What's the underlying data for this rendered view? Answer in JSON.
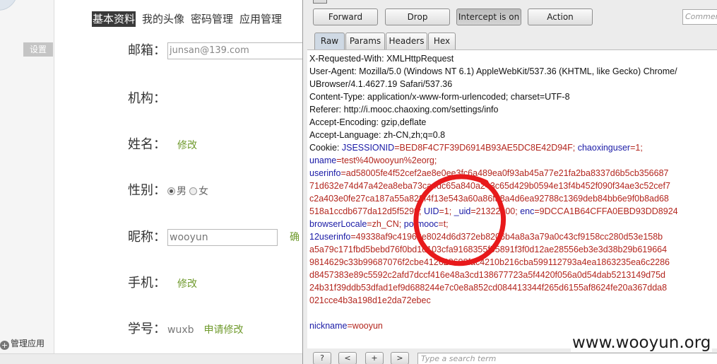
{
  "left_page": {
    "sidebar": {
      "settings_label": "设置",
      "manage_apps_label": "管理应用"
    },
    "tabs": [
      "基本资料",
      "我的头像",
      "密码管理",
      "应用管理"
    ],
    "fields": {
      "email": {
        "label": "邮箱：",
        "value": "junsan@139.com"
      },
      "org": {
        "label": "机构："
      },
      "name": {
        "label": "姓名：",
        "edit": "修改"
      },
      "gender": {
        "label": "性别：",
        "male": "男",
        "female": "女"
      },
      "nickname": {
        "label": "昵称：",
        "value": "wooyun",
        "confirm": "确"
      },
      "phone": {
        "label": "手机：",
        "edit": "修改"
      },
      "student_id": {
        "label": "学号：",
        "value": "wuxb",
        "apply": "申请修改"
      }
    }
  },
  "burp": {
    "toolbar": {
      "forward": "Forward",
      "drop": "Drop",
      "intercept": "Intercept is on",
      "action": "Action",
      "comment_placeholder": "Comment"
    },
    "tabs": [
      "Raw",
      "Params",
      "Headers",
      "Hex"
    ],
    "request": {
      "x_requested_with": "X-Requested-With: XMLHttpRequest",
      "user_agent_1": "User-Agent: Mozilla/5.0 (Windows NT 6.1) AppleWebKit/537.36 (KHTML, like Gecko) Chrome/",
      "user_agent_2": "UBrowser/4.1.4627.19 Safari/537.36",
      "content_type": "Content-Type: application/x-www-form-urlencoded; charset=UTF-8",
      "referer": "Referer: http://i.mooc.chaoxing.com/settings/info",
      "accept_encoding": "Accept-Encoding: gzip,deflate",
      "accept_language": "Accept-Language: zh-CN,zh;q=0.8",
      "cookie_prefix": "Cookie: ",
      "cookie_k1": "JSESSIONID",
      "cookie_v1": "=BED8F4C7F39D6914B93AE5DC8E42D94F; ",
      "cookie_k2": "chaoxinguser",
      "cookie_v2": "=1;",
      "uname_k": "uname",
      "uname_v": "=test%40wooyun%2eorg;",
      "userinfo_k": "userinfo",
      "userinfo_v1": "=ad58005fe4f52cef2ae8e0ee3fc6a489ea0f93ab45a77e21fa2ba8337d6b5cb356687",
      "userinfo_v2": "71d632e74d47a42ea8eba73ca4dc65a840a243c65d429b0594e13f4b452f090f34ae3c52cef7",
      "userinfo_v3": "c2a403e0fe27ca187a55a828f4f13e543a60a86fa8a4d6ea92788c1369deb84bb6e9f0b8ad68",
      "userinfo_v4": "518a1ccdb677da12d5f5299; ",
      "uid_k": "UID",
      "uid_v": "=1; ",
      "uid2_k": "_uid",
      "uid2_v": "=21322900; ",
      "enc_k": "enc",
      "enc_v": "=9DCCA1B64CFFA0EBD93DD8924",
      "locale_k": "browserLocale",
      "locale_v": "=zh_CN; ",
      "pormooc_k": "pormooc",
      "pormooc_v": "=t;",
      "u12_k": "12userinfo",
      "u12_v1": "=49338af9c41962e8024d6d372eb8206b4a8a3a79a0c43cf9158cc280d53e158b",
      "u12_v2": "a5a79c171fbd5bebd76f0bd1d103cfa9168355f55891f3f0d12ae28556eb3e3d38b29b619664",
      "u12_v3": "9814629c33b99687076f2cbe412628698fac4210b216cba599112793a4ea1863235ea6c2286",
      "u12_v4": "d8457383e89c5592c2afd7dccf416e48a3cd138677723a5f4420f056a0d54dab5213149d75d",
      "u12_v5": "24b31f39ddb53dfad1ef9d688244e7c0e8a852cd084413344f265d6155af8624fe20a367dda8",
      "u12_v6": "021cce4b3a198d1e2da72ebec",
      "nickname_k": "nickname",
      "nickname_v": "=wooyun"
    },
    "search": {
      "help": "?",
      "prev": "<",
      "add": "+",
      "next": ">",
      "placeholder": "Type a search term"
    }
  },
  "watermark": "www.wooyun.org",
  "colors": {
    "annotation": "#e8191b",
    "header_key": "#1a1aa6",
    "header_value": "#b3261e",
    "edit_link": "#6f9a2c"
  }
}
